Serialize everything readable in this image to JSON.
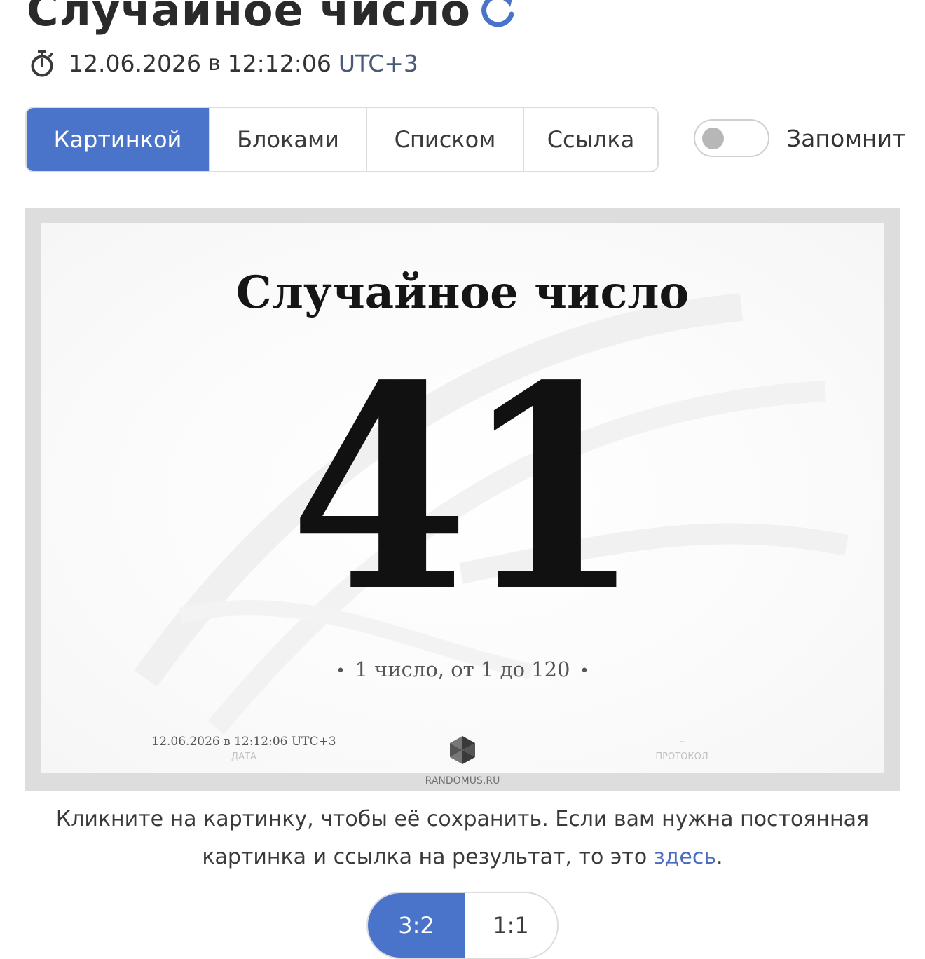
{
  "header": {
    "title": "Случайное число",
    "refresh_icon": "refresh-icon",
    "stopwatch_icon": "stopwatch-icon",
    "date": "12.06.2026",
    "date_time_separator": "в",
    "time": "12:12:06",
    "timezone": "UTC+3"
  },
  "view_tabs": [
    {
      "label": "Картинкой",
      "active": true
    },
    {
      "label": "Блоками",
      "active": false
    },
    {
      "label": "Списком",
      "active": false
    },
    {
      "label": "Ссылка",
      "active": false
    }
  ],
  "remember": {
    "label": "Запомнит",
    "enabled": false
  },
  "result_image": {
    "title": "Случайное число",
    "number": "41",
    "summary": "1 число, от 1 до 120",
    "bullet": "•",
    "date_value": "12.06.2026 в 12:12:06 UTC+3",
    "date_label": "ДАТА",
    "logo_icon": "randomus-logo-icon",
    "protocol_value": "–",
    "protocol_label": "ПРОТОКОЛ",
    "site": "RANDOMUS.RU"
  },
  "hint": {
    "text": "Кликните на картинку, чтобы её сохранить. Если вам нужна постоянная картинка и ссылка на результат, то это ",
    "link_text": "здесь",
    "suffix": "."
  },
  "ratio_options": [
    {
      "label": "3:2",
      "active": true
    },
    {
      "label": "1:1",
      "active": false
    }
  ],
  "colors": {
    "accent": "#4a74c9",
    "link": "#4a6cc0",
    "text": "#2b2b2b",
    "frame": "#dddddd"
  }
}
